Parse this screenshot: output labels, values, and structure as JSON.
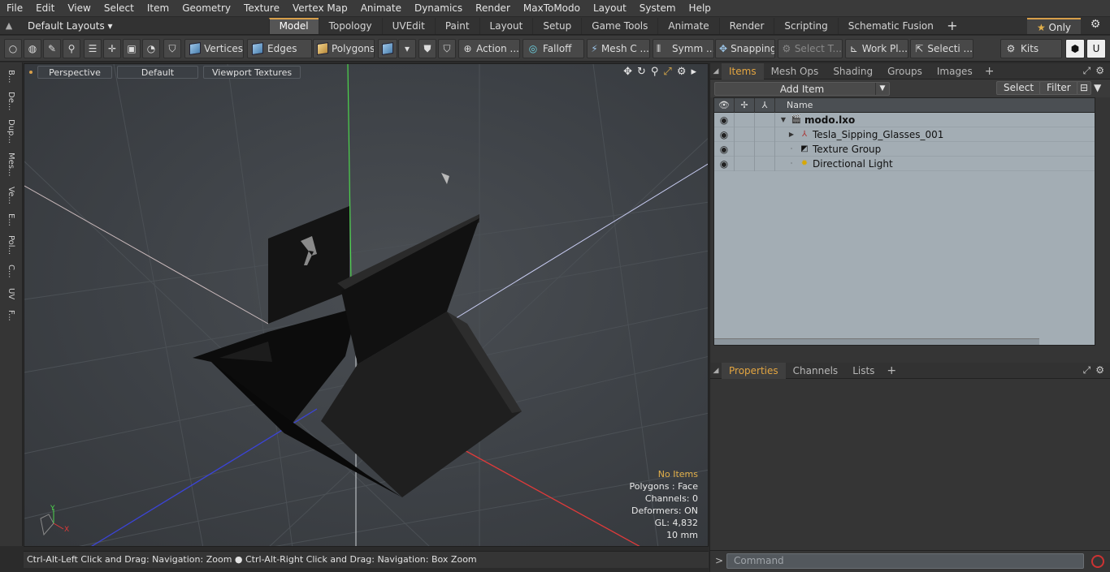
{
  "menubar": {
    "items": [
      "File",
      "Edit",
      "View",
      "Select",
      "Item",
      "Geometry",
      "Texture",
      "Vertex Map",
      "Animate",
      "Dynamics",
      "Render",
      "MaxToModo",
      "Layout",
      "System",
      "Help"
    ]
  },
  "layoutbar": {
    "layout_dropdown": "Default Layouts",
    "tabs": [
      "Model",
      "Topology",
      "UVEdit",
      "Paint",
      "Layout",
      "Setup",
      "Game Tools",
      "Animate",
      "Render",
      "Scripting",
      "Schematic Fusion"
    ],
    "active_tab": "Model",
    "only_label": "Only"
  },
  "toolbar": {
    "vertices": "Vertices",
    "edges": "Edges",
    "polygons": "Polygons",
    "action": "Action ...",
    "falloff": "Falloff",
    "mesh": "Mesh C ...",
    "symm": "Symm ...",
    "snapping": "Snapping",
    "select_t": "Select T...",
    "work_pl": "Work Pl...",
    "selecti": "Selecti ...",
    "kits": "Kits"
  },
  "leftstrip": {
    "tabs": [
      "B...",
      "De...",
      "Dup...",
      "Mes...",
      "Ve...",
      "E...",
      "Pol...",
      "C...",
      "UV",
      "F..."
    ]
  },
  "viewport": {
    "view_mode": "Perspective",
    "shading": "Default",
    "textures": "Viewport Textures",
    "info": {
      "no_items": "No Items",
      "polygons": "Polygons : Face",
      "channels": "Channels: 0",
      "deformers": "Deformers: ON",
      "gl": "GL: 4,832",
      "scale": "10 mm"
    },
    "axis": {
      "y": "Y",
      "x": "X"
    }
  },
  "statusbar": {
    "text": "Ctrl-Alt-Left Click and Drag: Navigation: Zoom ● Ctrl-Alt-Right Click and Drag: Navigation: Box Zoom"
  },
  "items_panel": {
    "tabs": [
      "Items",
      "Mesh Ops",
      "Shading",
      "Groups",
      "Images"
    ],
    "active_tab": "Items",
    "add_item": "Add Item",
    "select_btn": "Select",
    "filter_btn": "Filter",
    "column_name": "Name",
    "rows": [
      {
        "name": "modo.lxo",
        "bold": true
      },
      {
        "name": "Tesla_Sipping_Glasses_001"
      },
      {
        "name": "Texture Group"
      },
      {
        "name": "Directional Light"
      }
    ]
  },
  "props_panel": {
    "tabs": [
      "Properties",
      "Channels",
      "Lists"
    ],
    "active_tab": "Properties"
  },
  "command": {
    "placeholder": "Command"
  },
  "colors": {
    "accent": "#d79f4a",
    "active_tab_text": "#e3a540",
    "list_bg": "#a3adb4"
  }
}
